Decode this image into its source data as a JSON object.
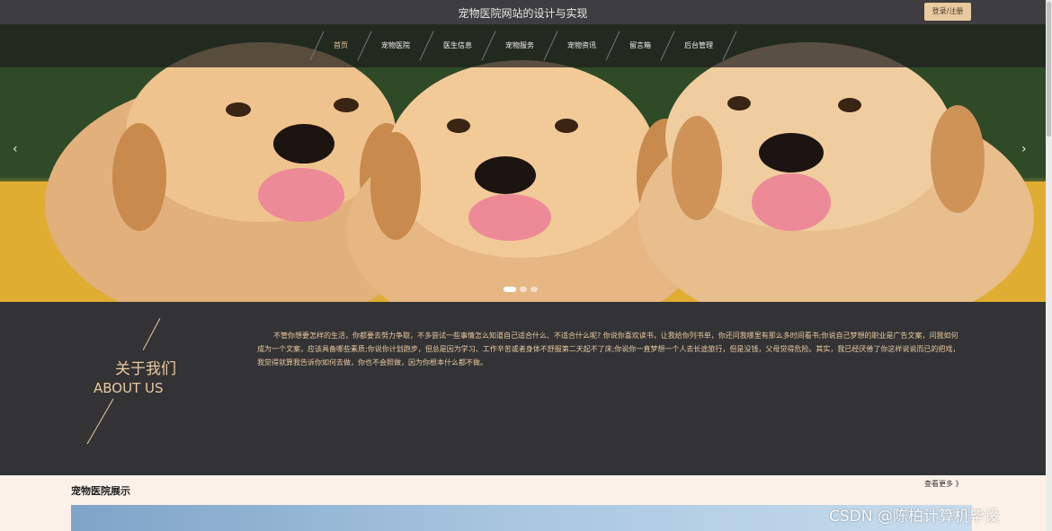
{
  "header": {
    "site_title": "宠物医院网站的设计与实现",
    "login_label": "登录/注册"
  },
  "nav": {
    "items": [
      "首页",
      "宠物医院",
      "医生信息",
      "宠物服务",
      "宠物资讯",
      "留言箱",
      "后台管理"
    ],
    "active_index": 0
  },
  "carousel": {
    "prev_icon": "‹",
    "next_icon": "›",
    "slide_count": 3,
    "active_slide": 0
  },
  "about": {
    "title_zh": "关于我们",
    "title_en": "ABOUT US",
    "text": "不管你想要怎样的生活，你都要去努力争取，不多尝试一些事情怎么知道自己适合什么、不适合什么呢? 你说你喜欢读书，让我给你列书单，你还问我哪里有那么多时间看书;你说自己梦想的职业是广告文案，问我如何成为一个文案，应该具备哪些素质;你说你计划跑步，但总是因为学习、工作辛苦或者身体不舒服第二天起不了床;你说你一直梦想一个人去长途旅行，但是没钱，父母觉得危险。其实，我已经厌倦了你这样说说而已的把戏，我觉得就算我告诉你如何去做，你也不会照做，因为你根本什么都不做。"
  },
  "showcase": {
    "title": "宠物医院展示",
    "more_label": "查看更多 》"
  },
  "watermark": "CSDN @陈柏计算机毕设",
  "colors": {
    "accent": "#e9c9a0",
    "dark_bg": "#333335",
    "topbar_bg": "#3e3e40"
  }
}
